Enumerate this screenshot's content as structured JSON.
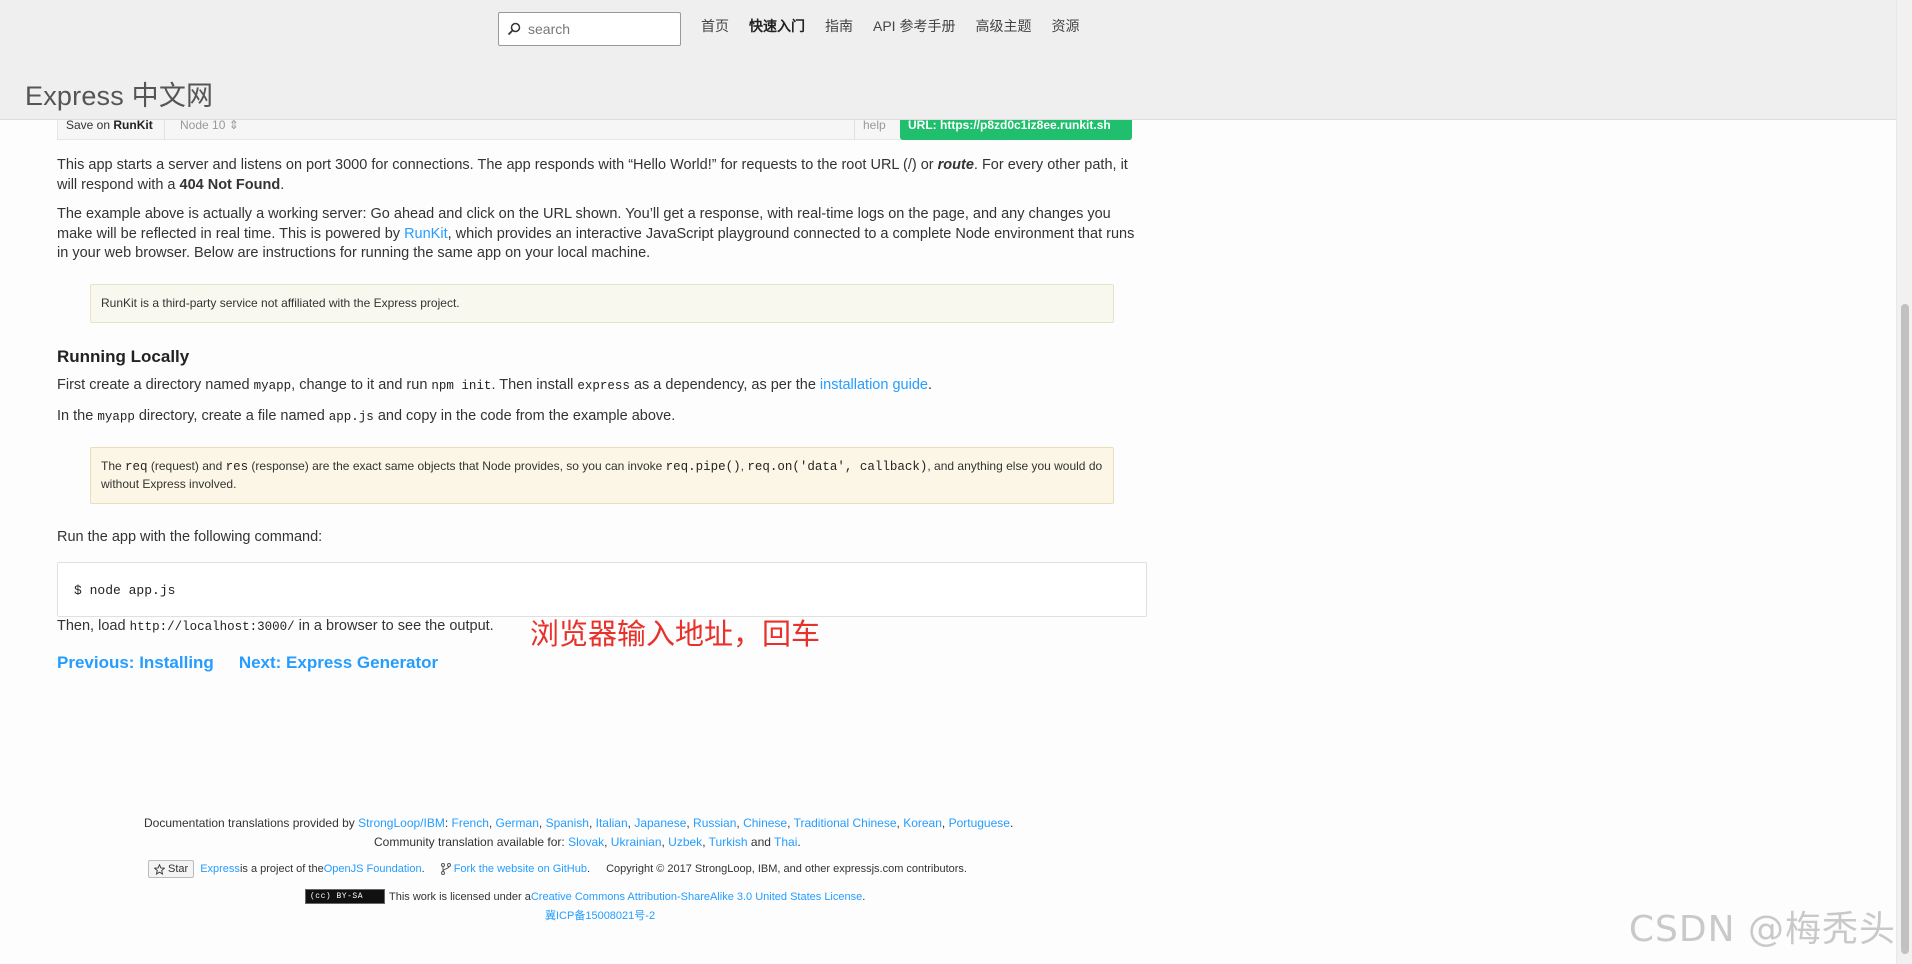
{
  "header": {
    "search_placeholder": "search",
    "nav": [
      "首页",
      "快速入门",
      "指南",
      "API 参考手册",
      "高级主题",
      "资源"
    ],
    "active_nav": "快速入门",
    "logo": "Express 中文网"
  },
  "runkit": {
    "save_prefix": "Save on ",
    "save_brand": "RunKit",
    "node_version": "Node 10 ⇕",
    "help": "help",
    "url_label": "URL: ",
    "url": "https://p8zd0c1iz8ee.runkit.sh"
  },
  "content": {
    "p1": {
      "a": "This app starts a server and listens on port 3000 for connections. The app responds with “Hello World!” for requests to the root URL (",
      "b": "/",
      "c": ") or ",
      "d": "route",
      "e": ". For every other path, it will respond with a ",
      "f": "404 Not Found",
      "g": "."
    },
    "p2": {
      "a": "The example above is actually a working server: Go ahead and click on the URL shown. You’ll get a response, with real-time logs on the page, and any changes you make will be reflected in real time. This is powered by ",
      "link": "RunKit",
      "b": ", which provides an interactive JavaScript playground connected to a complete Node environment that runs in your web browser. Below are instructions for running the same app on your local machine."
    },
    "note1": "RunKit is a third-party service not affiliated with the Express project.",
    "heading": "Running Locally",
    "p3": {
      "a": "First create a directory named ",
      "code1": "myapp",
      "b": ", change to it and run ",
      "code2": "npm init",
      "c": ". Then install ",
      "code3": "express",
      "d": " as a dependency, as per the ",
      "link": "installation guide",
      "e": "."
    },
    "p4": {
      "a": "In the ",
      "code1": "myapp",
      "b": " directory, create a file named ",
      "code2": "app.js",
      "c": " and copy in the code from the example above."
    },
    "note2": {
      "a": "The ",
      "code1": "req",
      "b": " (request) and ",
      "code2": "res",
      "c": " (response) are the exact same objects that Node provides, so you can invoke ",
      "code3": "req.pipe()",
      "d": ", ",
      "code4": "req.on('data', callback)",
      "e": ", and anything else you would do without Express involved."
    },
    "p5": "Run the app with the following command:",
    "command": "$ node app.js",
    "p6": {
      "a": "Then, load ",
      "code": "http://localhost:3000/",
      "b": " in a browser to see the output."
    },
    "annotation": "浏览器输入地址，回车",
    "prev": "Previous: Installing",
    "next": "Next: Express Generator"
  },
  "footer": {
    "row1_prefix": "Documentation translations provided by ",
    "row1_ibm": "StrongLoop/IBM",
    "row1_langs": [
      "French",
      "German",
      "Spanish",
      "Italian",
      "Japanese",
      "Russian",
      "Chinese",
      "Traditional Chinese",
      "Korean",
      "Portuguese"
    ],
    "row2_prefix": "Community translation available for: ",
    "row2_langs": [
      "Slovak",
      "Ukrainian",
      "Uzbek",
      "Turkish"
    ],
    "row2_and": "and",
    "row2_last": "Thai",
    "star": "Star",
    "express": "Express",
    "project_of": " is a project of the ",
    "openjs": "OpenJS Foundation",
    "fork": "Fork the website on GitHub",
    "copyright": "Copyright © 2017 StrongLoop, IBM, and other expressjs.com contributors.",
    "cc_badge": "(cc) BY-SA",
    "license_prefix": "This work is licensed under a ",
    "license_link": "Creative Commons Attribution-ShareAlike 3.0 United States License",
    "icp": "冀ICP备15008021号-2"
  },
  "watermark": "CSDN @梅秃头"
}
